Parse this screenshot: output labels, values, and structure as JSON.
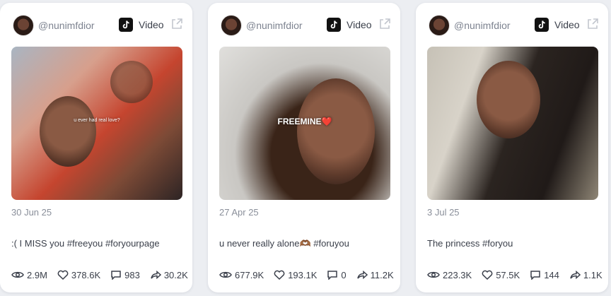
{
  "colors": {
    "page_background": "#eceef2",
    "card_background": "#ffffff",
    "text_primary": "#3a3f4a",
    "text_muted": "#8a8f9a"
  },
  "cards": [
    {
      "username": "@nunimfdior",
      "platform_icon": "tiktok-icon",
      "type_label": "Video",
      "media_caption": "u ever had real love?",
      "date": "30 Jun 25",
      "caption": ":( I MISS you #freeyou #foryourpage",
      "stats": {
        "views": "2.9M",
        "likes": "378.6K",
        "comments": "983",
        "shares": "30.2K"
      }
    },
    {
      "username": "@nunimfdior",
      "platform_icon": "tiktok-icon",
      "type_label": "Video",
      "media_caption": "FREEMINE❤️",
      "date": "27 Apr 25",
      "caption": "u never really alone🫶🏾 #foruyou",
      "stats": {
        "views": "677.9K",
        "likes": "193.1K",
        "comments": "0",
        "shares": "11.2K"
      }
    },
    {
      "username": "@nunimfdior",
      "platform_icon": "tiktok-icon",
      "type_label": "Video",
      "media_caption": "",
      "date": "3 Jul 25",
      "caption": "The princess #foryou",
      "stats": {
        "views": "223.3K",
        "likes": "57.5K",
        "comments": "144",
        "shares": "1.1K"
      }
    }
  ]
}
